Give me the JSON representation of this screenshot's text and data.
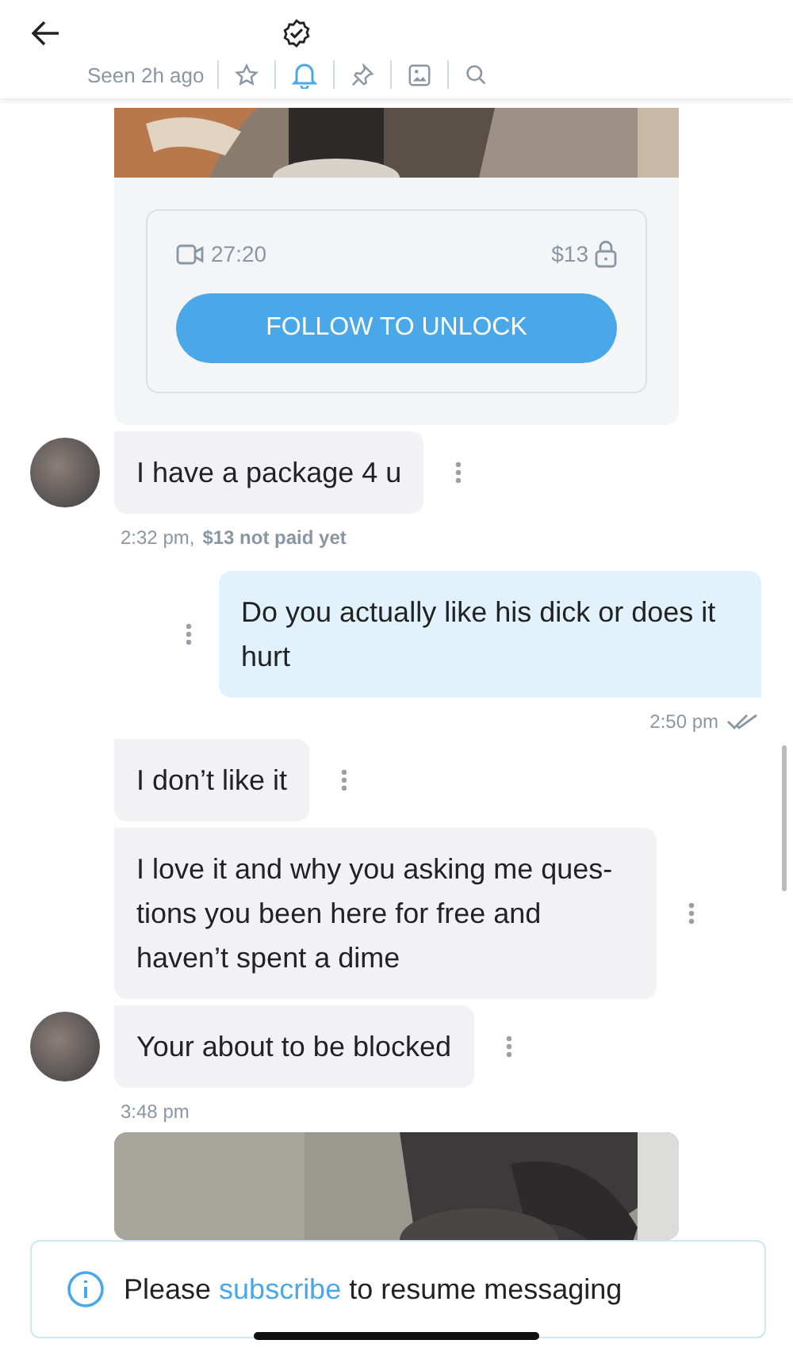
{
  "header": {
    "verified": true,
    "status": "Seen 2h ago",
    "notifications_on": true
  },
  "messages": [
    {
      "kind": "locked_media",
      "duration": "27:20",
      "price": "$13",
      "button": "FOLLOW TO UNLOCK"
    },
    {
      "kind": "text",
      "outgoing": false,
      "avatar": true,
      "text": "I have a package 4 u"
    },
    {
      "kind": "meta",
      "outgoing": false,
      "time": "2:32 pm,",
      "note": "$13 not paid yet"
    },
    {
      "kind": "text",
      "outgoing": true,
      "avatar": false,
      "text": "Do you actually like his dick or does it hurt"
    },
    {
      "kind": "meta",
      "outgoing": true,
      "time": "2:50 pm",
      "read": true
    },
    {
      "kind": "text",
      "outgoing": false,
      "avatar": false,
      "text": "I don’t like it"
    },
    {
      "kind": "text",
      "outgoing": false,
      "avatar": false,
      "text": "I love it and why you asking me ques-tions you been here for free and haven’t spent a dime"
    },
    {
      "kind": "text",
      "outgoing": false,
      "avatar": true,
      "text": "Your about to be blocked"
    },
    {
      "kind": "meta",
      "outgoing": false,
      "time": "3:48 pm"
    },
    {
      "kind": "media"
    }
  ],
  "banner": {
    "before": "Please ",
    "link": "subscribe",
    "after": " to resume messaging"
  }
}
